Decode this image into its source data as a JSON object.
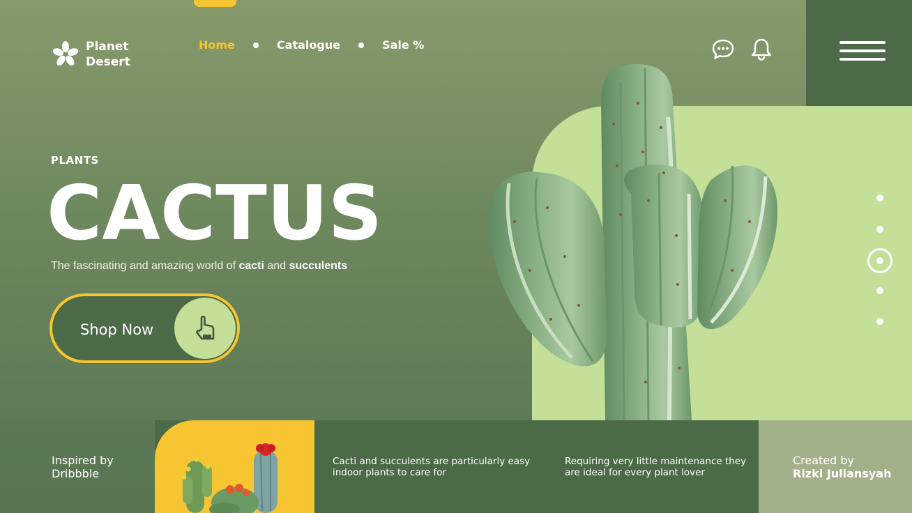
{
  "brand": {
    "line1": "Planet",
    "line2": "Desert",
    "icon": "asterisk-flower-icon"
  },
  "nav": {
    "items": [
      {
        "label": "Home",
        "active": true
      },
      {
        "label": "Catalogue",
        "active": false
      },
      {
        "label": "Sale %",
        "active": false
      }
    ]
  },
  "header_icons": [
    "chat-icon",
    "bell-icon",
    "menu-icon"
  ],
  "hero": {
    "eyebrow": "PLANTS",
    "title": "CACTUS",
    "tagline_pre": "The fascinating and amazing world of ",
    "tagline_b1": "cacti",
    "tagline_mid": " and ",
    "tagline_b2": "succulents",
    "cta_label": "Shop Now",
    "cta_icon": "pointer-hand-icon"
  },
  "pager": {
    "count": 5,
    "active_index": 2
  },
  "footer": {
    "inspired_line1": "Inspired by",
    "inspired_line2": "Dribbble",
    "info1": "Cacti and succulents are particularly easy indoor plants to care for",
    "info2": "Requiring very little maintenance they are ideal for every plant lover",
    "credit_line1": "Created by",
    "credit_line2": "Rizki Juliansyah"
  },
  "colors": {
    "accent_yellow": "#f7c531",
    "dark_green": "#4c6a48",
    "light_green": "#c4df97",
    "sage": "#a3b18a"
  }
}
